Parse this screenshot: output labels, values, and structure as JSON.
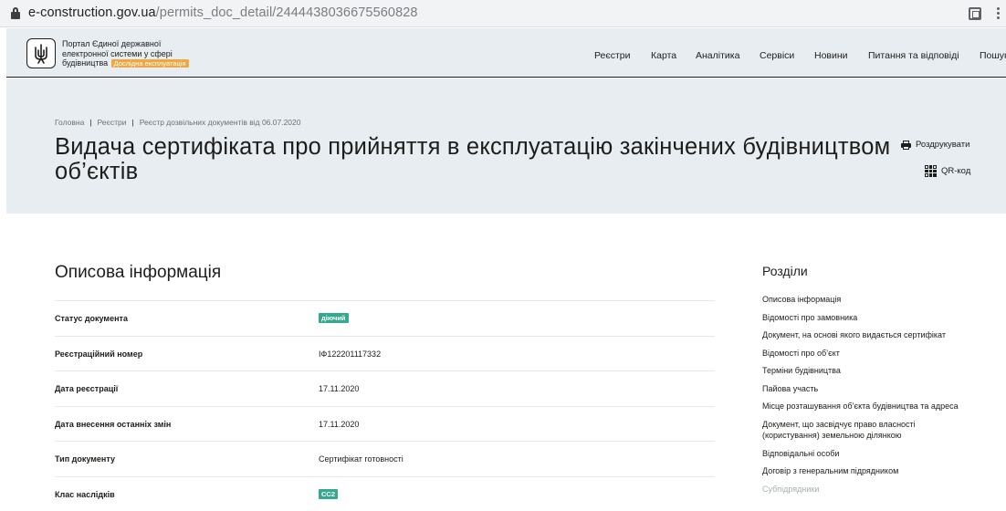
{
  "browser": {
    "url_domain": "e-construction.gov.ua",
    "url_path": "/permits_doc_detail/2444438036675560828"
  },
  "header": {
    "portal_name": "Портал Єдиної державної електронної системи у сфері будівництва",
    "beta_badge": "Дослідна експлуатація",
    "nav": [
      "Реєстри",
      "Карта",
      "Аналітика",
      "Сервіси",
      "Новини",
      "Питання та відповіді",
      "Пошук"
    ]
  },
  "breadcrumb": [
    "Головна",
    "Реєстри",
    "Реєстр дозвільних документів від 06.07.2020"
  ],
  "page_title": "Видача сертифіката про прийняття в експлуатацію закінчених будівництвом об’єктів",
  "actions": {
    "print_label": "Роздрукувати",
    "qr_label": "QR-код"
  },
  "main": {
    "heading": "Описова інформація",
    "rows": [
      {
        "label": "Статус документа",
        "badge": "діючий",
        "badge_color": "#35a98d"
      },
      {
        "label": "Реєстраційний номер",
        "value": "ІФ122201117332"
      },
      {
        "label": "Дата реєстрації",
        "value": "17.11.2020"
      },
      {
        "label": "Дата внесення останніх змін",
        "value": "17.11.2020"
      },
      {
        "label": "Тип документу",
        "value": "Сертифікат готовності"
      },
      {
        "label": "Клас наслідків",
        "badge": "СС2",
        "badge_color": "#35a98d"
      }
    ]
  },
  "sidebar": {
    "heading": "Розділи",
    "items": [
      "Описова інформація",
      "Відомості про замовника",
      "Документ, на основі якого видається сертифікат",
      "Відомості про об’єкт",
      "Терміни будівництва",
      "Пайова участь",
      "Місце розташування об’єкта будівництва та адреса",
      "Документ, що засвідчує право власності (користування) земельною ділянкою",
      "Відповідальні особи",
      "Договір з генеральним підрядником",
      "Субпідрядники"
    ]
  },
  "colors": {
    "header_bg": "#e8edf2",
    "accent_badge": "#35a98d",
    "beta_badge": "#f0a742"
  }
}
